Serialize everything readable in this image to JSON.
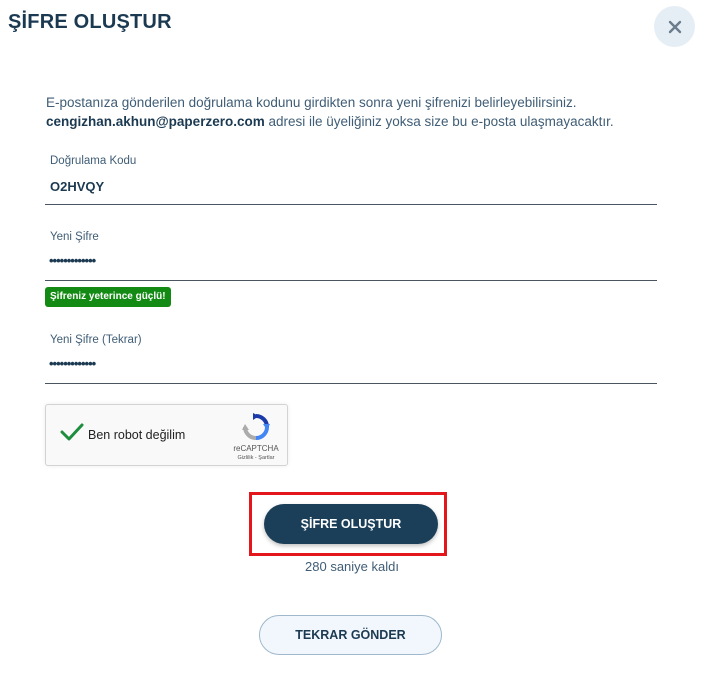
{
  "header": {
    "title": "ŞİFRE OLUŞTUR",
    "close_icon": "close-icon"
  },
  "intro": {
    "line1": "E-postanıza gönderilen doğrulama kodunu girdikten sonra yeni şifrenizi belirleyebilirsiniz.",
    "email": "cengizhan.akhun@paperzero.com",
    "line2_rest": " adresi ile üyeliğiniz yoksa size bu e-posta ulaşmayacaktır."
  },
  "form": {
    "code": {
      "label": "Doğrulama Kodu",
      "value": "O2HVQY"
    },
    "new_password": {
      "label": "Yeni Şifre",
      "value": "•••••••••••••"
    },
    "strength_badge": {
      "text": "Şifreniz yeterince güçlü!",
      "color": "#138a13"
    },
    "confirm_password": {
      "label": "Yeni Şifre (Tekrar)",
      "value": "•••••••••••••"
    }
  },
  "captcha": {
    "label": "Ben robot değilim",
    "brand": "reCAPTCHA",
    "links": "Gizlilik - Şartlar",
    "checked": true,
    "check_color": "#1e8e3e"
  },
  "actions": {
    "submit_label": "ŞİFRE OLUŞTUR",
    "countdown": "280 saniye kaldı",
    "resend_label": "TEKRAR GÖNDER",
    "highlight_color": "#e3161b",
    "primary_color": "#1b3f58"
  }
}
